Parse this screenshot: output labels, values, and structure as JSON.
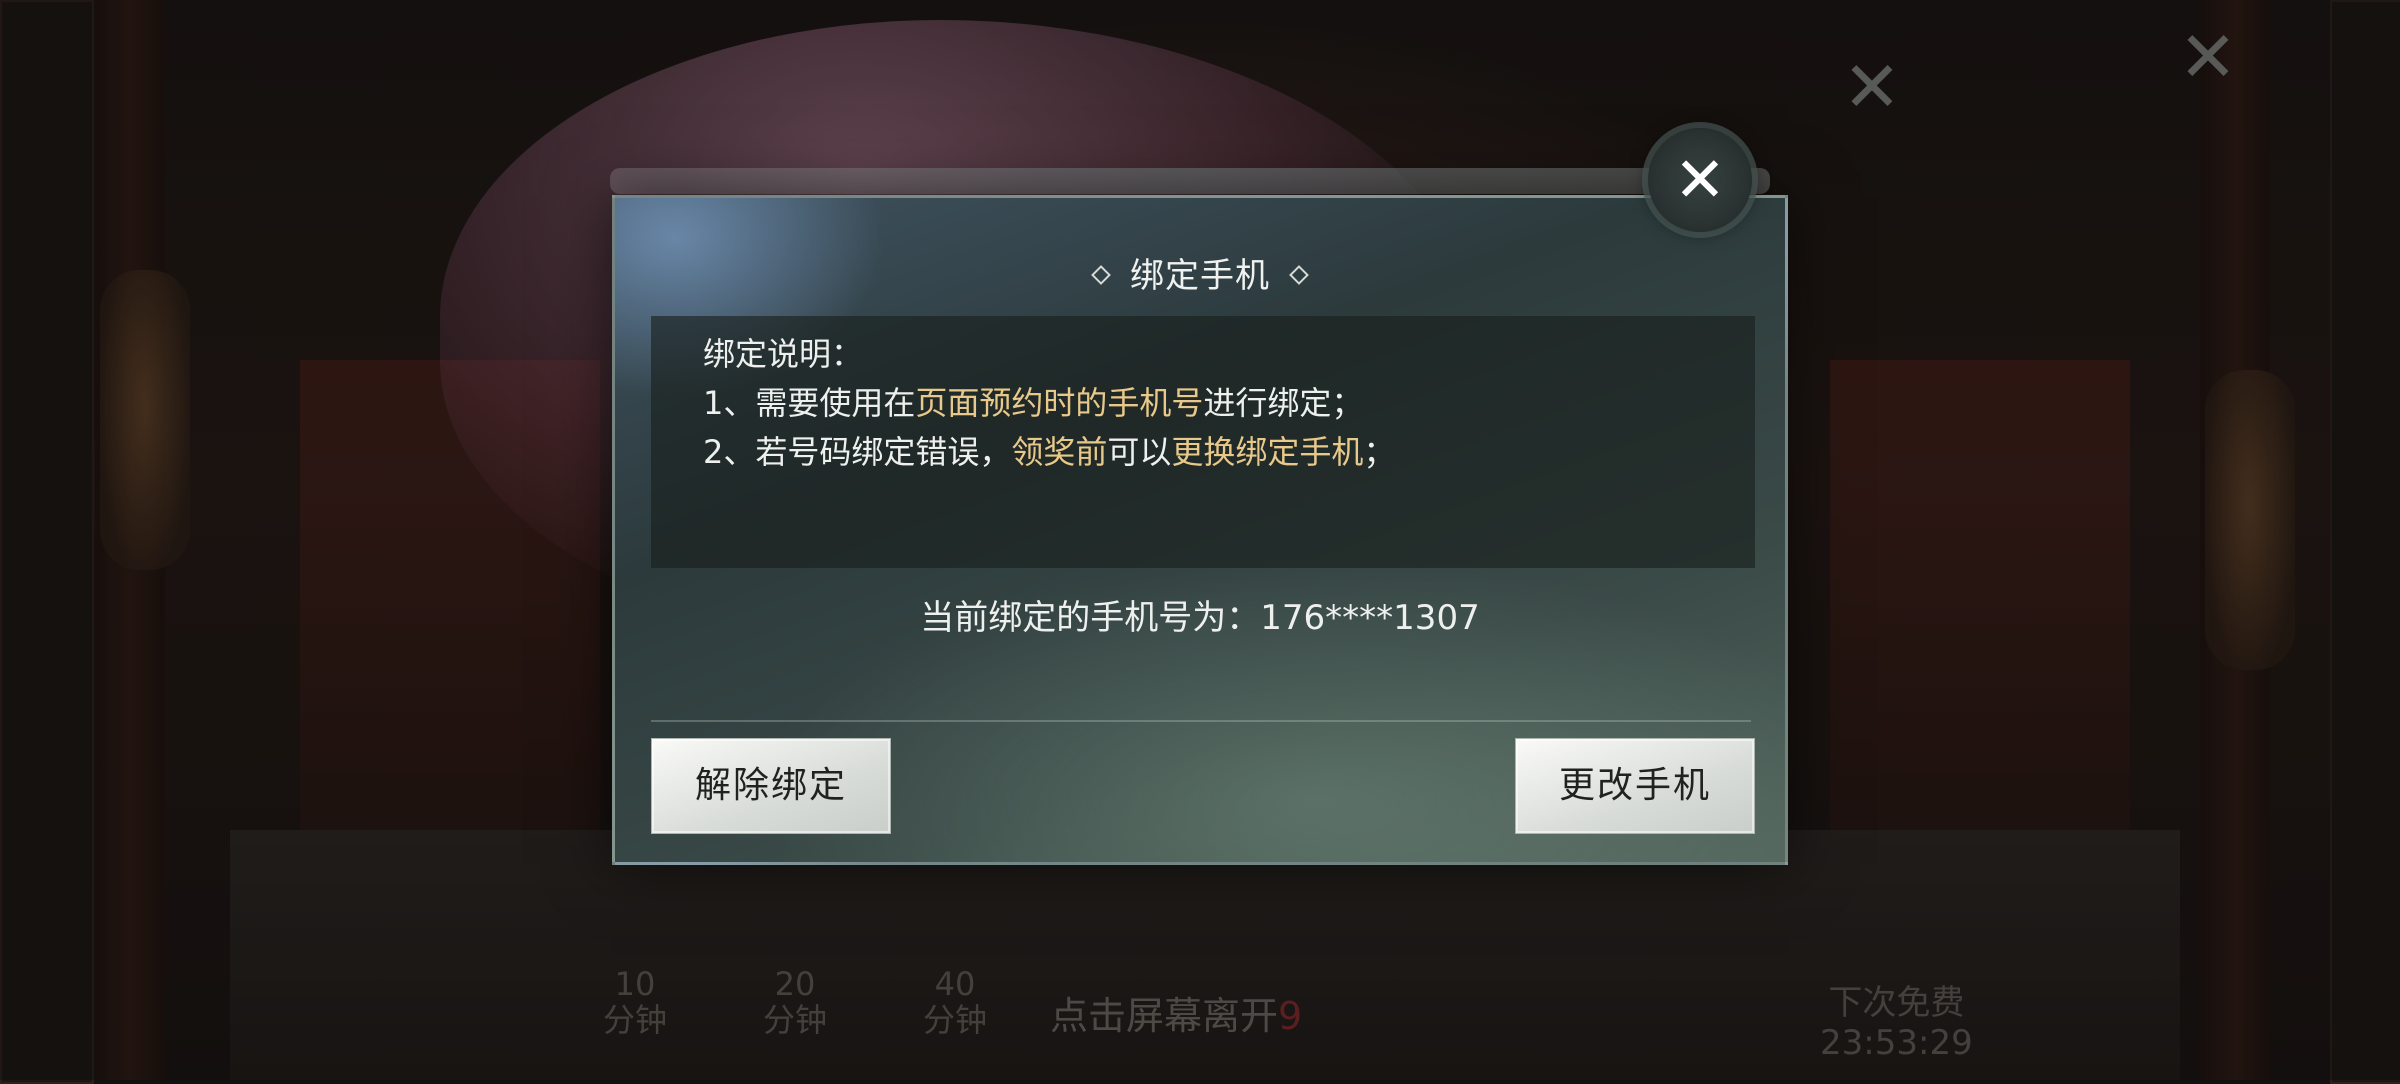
{
  "background": {
    "close_icon_glyph": "✕",
    "bottom_labels": [
      {
        "num": "10",
        "unit": "分钟"
      },
      {
        "num": "20",
        "unit": "分钟"
      },
      {
        "num": "40",
        "unit": "分钟"
      }
    ],
    "leave_text": "点击屏幕离开",
    "leave_count": "9",
    "next_free_label": "下次免费",
    "next_free_timer": "23:53:29"
  },
  "dialog": {
    "title": "绑定手机",
    "info": {
      "heading": "绑定说明：",
      "line1": {
        "prefix": "1、需要使用在",
        "highlight": "页面预约时的手机号",
        "suffix": "进行绑定；"
      },
      "line2": {
        "prefix": "2、若号码绑定错误，",
        "highlight1": "领奖前",
        "middle": "可以",
        "highlight2": "更换绑定手机",
        "suffix": "；"
      }
    },
    "phone_label": "当前绑定的手机号为：176****1307",
    "unbind_button": "解除绑定",
    "change_button": "更改手机",
    "close_icon_glyph": "✕"
  },
  "colors": {
    "highlight": "#e8c98a",
    "button_text": "#1f2220"
  }
}
